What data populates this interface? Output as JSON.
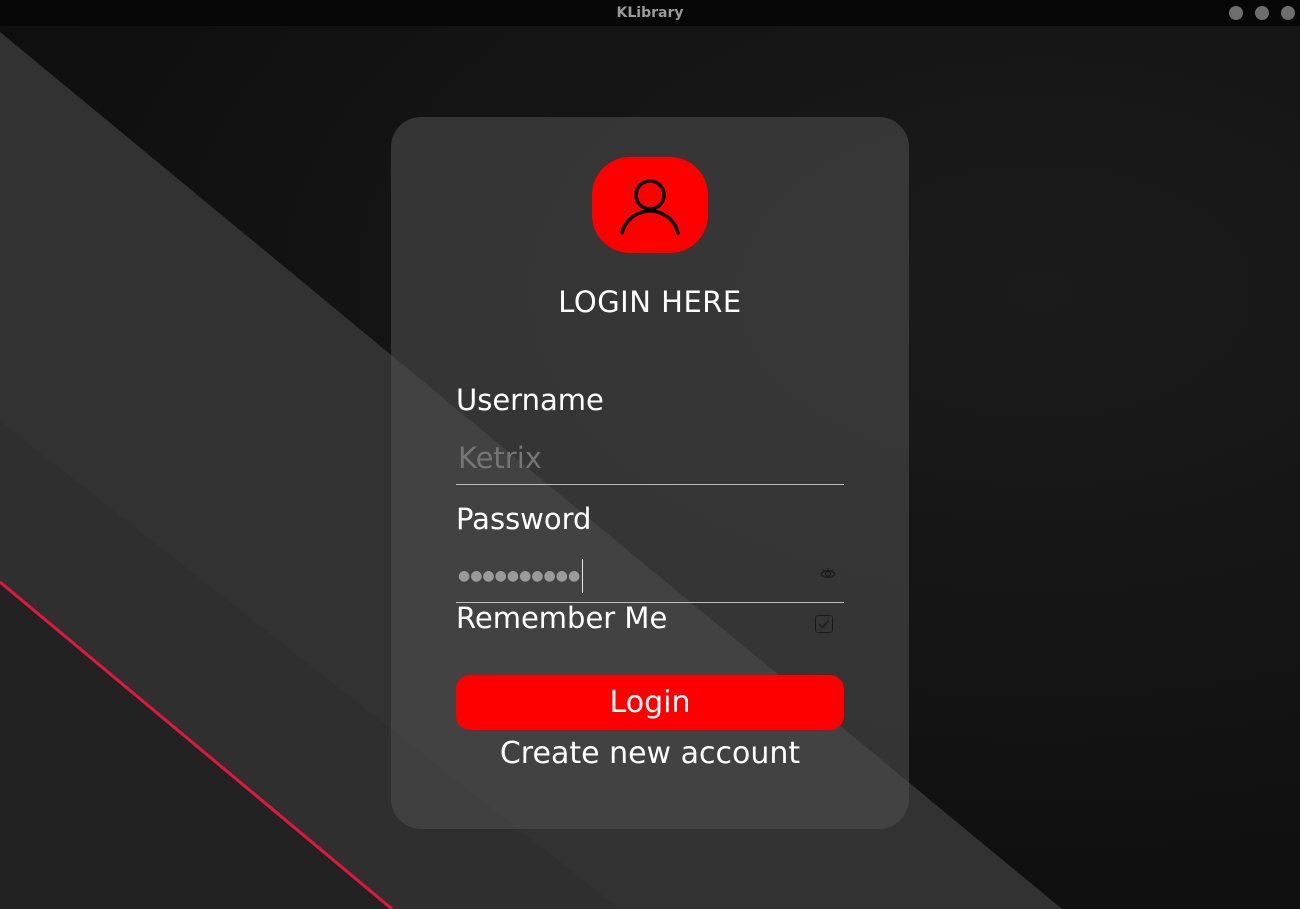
{
  "window": {
    "title": "KLibrary"
  },
  "colors": {
    "accent": "#ff0000",
    "accent_line": "#e3173d",
    "card": "#4e4e4e",
    "text": "#ffffff",
    "placeholder": "#8d8d8d"
  },
  "form": {
    "avatar_icon": "user-icon",
    "heading": "LOGIN HERE",
    "username": {
      "label": "Username",
      "placeholder": "Ketrix",
      "value": ""
    },
    "password": {
      "label": "Password",
      "masked_value": "●●●●●●●●●●",
      "toggle_icon": "eye-icon"
    },
    "remember": {
      "label": "Remember Me",
      "checked": true
    },
    "login_button": "Login",
    "create_account_link": "Create new account"
  }
}
